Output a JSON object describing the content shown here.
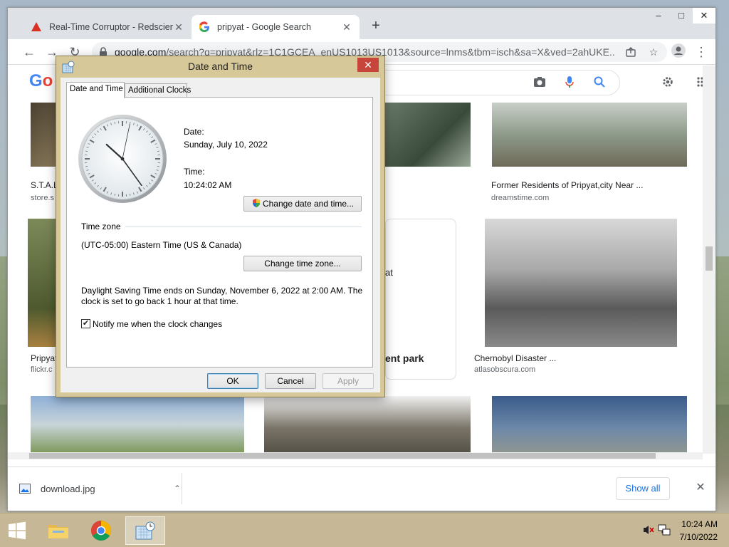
{
  "browser": {
    "tabs": [
      {
        "title": "Real-Time Corruptor - Redscienti",
        "active": false
      },
      {
        "title": "pripyat - Google Search",
        "active": true
      }
    ],
    "new_tab_label": "+",
    "window_controls": {
      "minimize": "–",
      "maximize": "□",
      "close": "✕"
    },
    "url_host": "google.com",
    "url_rest": "/search?q=pripyat&rlz=1C1GCEA_enUS1013US1013&source=lnms&tbm=isch&sa=X&ved=2ahUKE..."
  },
  "page": {
    "results": [
      {
        "caption": "S.T.A.L",
        "source": "store.s"
      },
      {
        "caption": "Former Residents of Pripyat,city Near ...",
        "source": "dreamstime.com"
      },
      {
        "caption": "Pripyat",
        "source": "flickr.c"
      },
      {
        "caption": "Chernobyl Disaster ...",
        "source": "atlasobscura.com"
      }
    ],
    "card_fragment_1": "at",
    "card_fragment_2": "ent park"
  },
  "downloads": {
    "file_name": "download.jpg",
    "show_all": "Show all"
  },
  "dialog": {
    "title": "Date and Time",
    "tabs": [
      "Date and Time",
      "Additional Clocks"
    ],
    "date_label": "Date:",
    "date_value": "Sunday, July 10, 2022",
    "time_label": "Time:",
    "time_value": "10:24:02 AM",
    "change_datetime_button": "Change date and time...",
    "timezone_heading": "Time zone",
    "timezone_value": "(UTC-05:00) Eastern Time (US & Canada)",
    "change_timezone_button": "Change time zone...",
    "dst_line1": "Daylight Saving Time ends on Sunday, November 6, 2022 at 2:00 AM. The",
    "dst_line2": "clock is set to go back 1 hour at that time.",
    "notify_label": "Notify me when the clock changes",
    "notify_checked": true,
    "ok": "OK",
    "cancel": "Cancel",
    "apply": "Apply"
  },
  "clock_hands": {
    "hour": 10,
    "minute": 24,
    "second": 2
  },
  "taskbar": {
    "time": "10:24 AM",
    "date": "7/10/2022"
  }
}
